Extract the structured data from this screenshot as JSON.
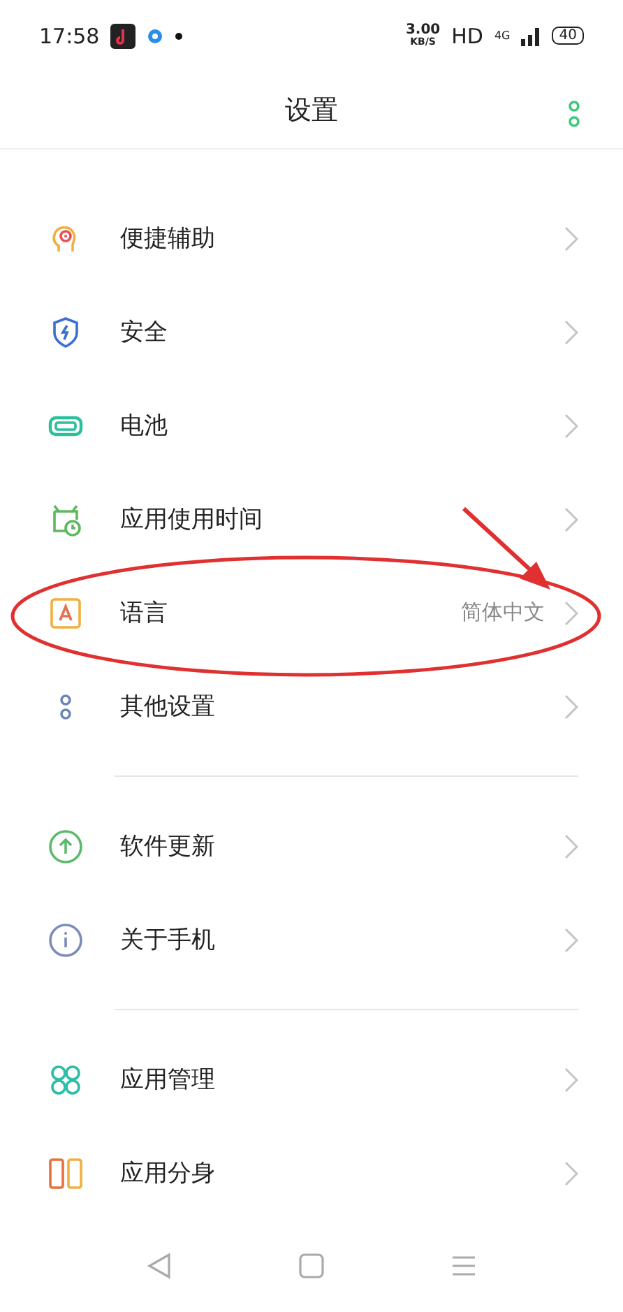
{
  "status_bar": {
    "time": "17:58",
    "speed": "3.00",
    "speed_unit": "KB/S",
    "hd": "HD",
    "network": "4G",
    "battery": "40"
  },
  "header": {
    "title": "设置"
  },
  "groups": [
    {
      "items": [
        {
          "kind": "accessibility",
          "label": "便捷辅助"
        },
        {
          "kind": "shield",
          "label": "安全"
        },
        {
          "kind": "battery",
          "label": "电池"
        },
        {
          "kind": "timer",
          "label": "应用使用时间"
        },
        {
          "kind": "language",
          "label": "语言",
          "value": "简体中文"
        },
        {
          "kind": "dots",
          "label": "其他设置"
        }
      ]
    },
    {
      "items": [
        {
          "kind": "update",
          "label": "软件更新"
        },
        {
          "kind": "info",
          "label": "关于手机"
        }
      ]
    },
    {
      "items": [
        {
          "kind": "apps",
          "label": "应用管理"
        },
        {
          "kind": "clone",
          "label": "应用分身"
        }
      ]
    }
  ]
}
